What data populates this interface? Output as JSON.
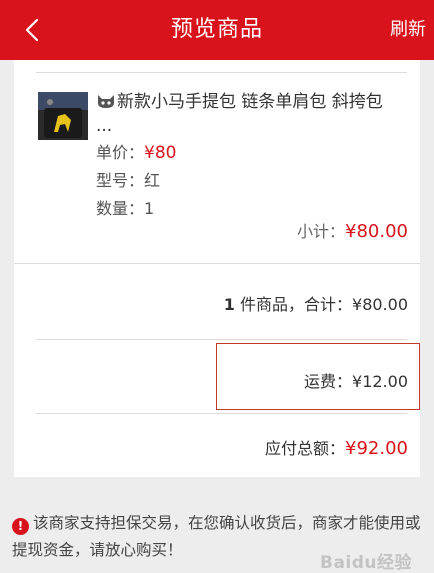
{
  "header": {
    "title": "预览商品",
    "refresh_label": "刷新",
    "color": "#d9131b"
  },
  "product": {
    "title": "新款小马手提包 链条单肩包 斜挎包 ...",
    "unit_price_label": "单价：",
    "unit_price": "¥80",
    "model_label": "型号：",
    "model": "红",
    "quantity_label": "数量：",
    "quantity": "1",
    "subtotal_label": "小计：",
    "subtotal": "¥80.00"
  },
  "summary": {
    "count": "1",
    "count_text": " 件商品，合计：¥80.00",
    "shipping_label": "运费：",
    "shipping": "¥12.00",
    "total_label": "应付总额：",
    "total": "¥92.00"
  },
  "notice": {
    "icon": "exclamation-circle-icon",
    "text": "该商家支持担保交易，在您确认收货后，商家才能使用或提现资金，请放心购买！"
  },
  "watermark": "Baidu经验"
}
